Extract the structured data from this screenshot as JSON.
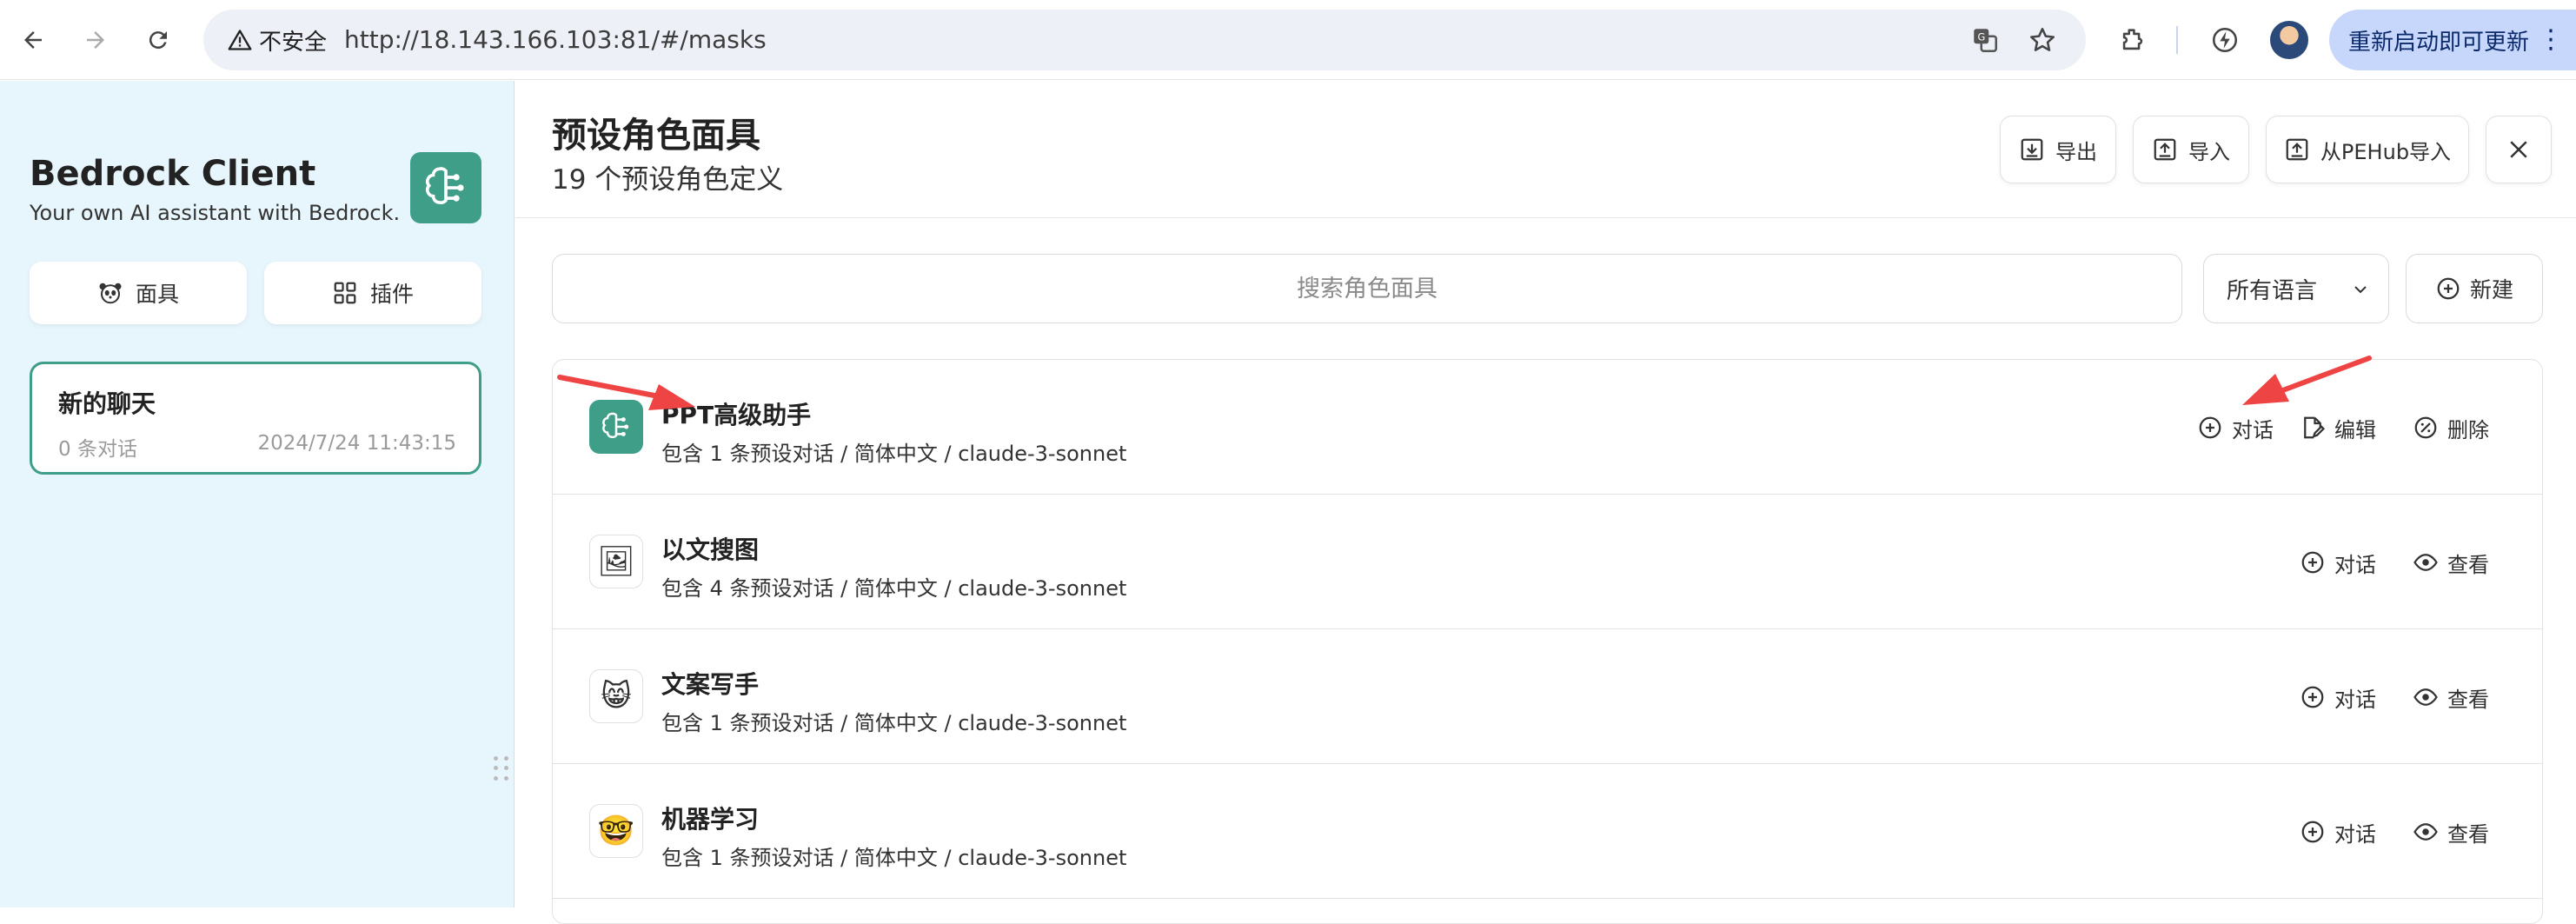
{
  "browser": {
    "security_label": "不安全",
    "url": "http://18.143.166.103:81/#/masks",
    "update_button_label": "重新启动即可更新"
  },
  "sidebar": {
    "title": "Bedrock Client",
    "subtitle": "Your own AI assistant with Bedrock.",
    "masks_button_label": "面具",
    "plugins_button_label": "插件",
    "chats": [
      {
        "title": "新的聊天",
        "count": "0 条对话",
        "time": "2024/7/24 11:43:15"
      }
    ]
  },
  "main": {
    "title": "预设角色面具",
    "subtitle": "19 个预设角色定义",
    "export_label": "导出",
    "import_label": "导入",
    "pehub_import_label": "从PEHub导入",
    "search_placeholder": "搜索角色面具",
    "language_select": "所有语言",
    "new_label": "新建",
    "masks": [
      {
        "name": "PPT高级助手",
        "meta": "包含 1 条预设对话 / 简体中文 / claude-3-sonnet",
        "chat_label": "对话",
        "edit_label": "编辑",
        "delete_label": "删除"
      },
      {
        "name": "以文搜图",
        "meta": "包含 4 条预设对话 / 简体中文 / claude-3-sonnet",
        "chat_label": "对话",
        "view_label": "查看"
      },
      {
        "name": "文案写手",
        "meta": "包含 1 条预设对话 / 简体中文 / claude-3-sonnet",
        "chat_label": "对话",
        "view_label": "查看"
      },
      {
        "name": "机器学习",
        "meta": "包含 1 条预设对话 / 简体中文 / claude-3-sonnet",
        "chat_label": "对话",
        "view_label": "查看"
      }
    ]
  },
  "colors": {
    "accent": "#3f9e87",
    "sidebar_bg": "#e7f6fc",
    "annotation_arrow": "#ef4444"
  }
}
